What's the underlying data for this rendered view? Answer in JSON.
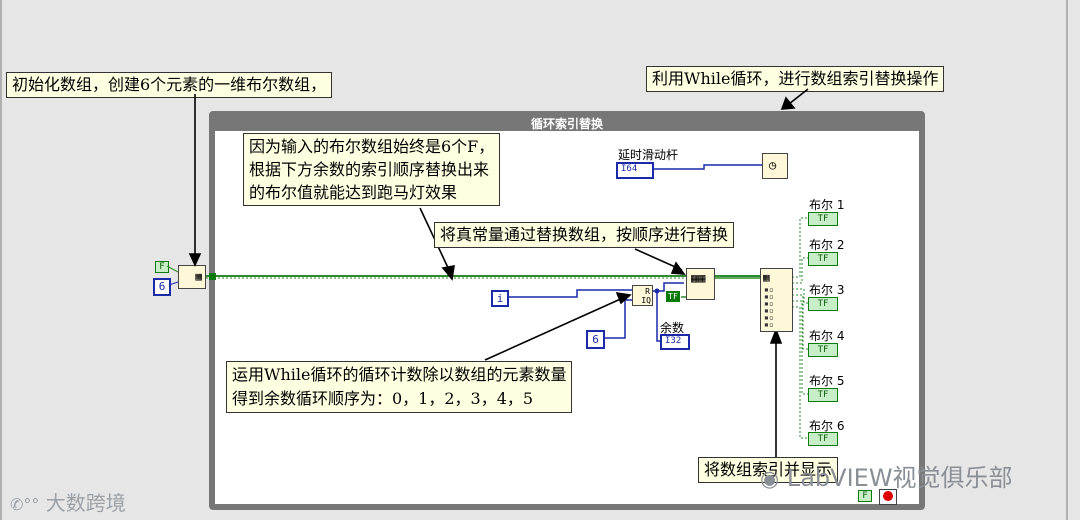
{
  "notes": {
    "init_array": "初始化数组，创建6个元素的一维布尔数组，",
    "while_loop": "利用While循环，进行数组索引替换操作",
    "explain_line1": "因为输入的布尔数组始终是6个F，",
    "explain_line2": "根据下方余数的索引顺序替换出来",
    "explain_line3": "的布尔值就能达到跑马灯效果",
    "replace": "将真常量通过替换数组，按顺序进行替换",
    "iteration_line1": "运用While循环的循环计数除以数组的元素数量",
    "iteration_line2": "得到余数循环顺序为：0，1，2，3，4，5",
    "index_display": "将数组索引并显示"
  },
  "loop_title": "循环索引替换",
  "delay_slider_label": "延时滑动杆",
  "delay_terminal_type": "I64",
  "remainder_label": "余数",
  "remainder_type": "I32",
  "constants": {
    "false_const": "F",
    "size_const": "6",
    "iteration": "i",
    "divisor": "6",
    "true_const": "TF",
    "stop_false": "F"
  },
  "bool_indicators": [
    {
      "label": "布尔 1",
      "type": "TF"
    },
    {
      "label": "布尔 2",
      "type": "TF"
    },
    {
      "label": "布尔 3",
      "type": "TF"
    },
    {
      "label": "布尔 4",
      "type": "TF"
    },
    {
      "label": "布尔 5",
      "type": "TF"
    },
    {
      "label": "布尔 6",
      "type": "TF"
    }
  ],
  "watermarks": {
    "left": "大数跨境",
    "right": "LabVIEW视觉俱乐部"
  },
  "colors": {
    "boolean_wire": "#2e8b2e",
    "integer_wire": "#1a2aa8",
    "loop_border": "#777777",
    "note_bg": "#ffffe1"
  }
}
